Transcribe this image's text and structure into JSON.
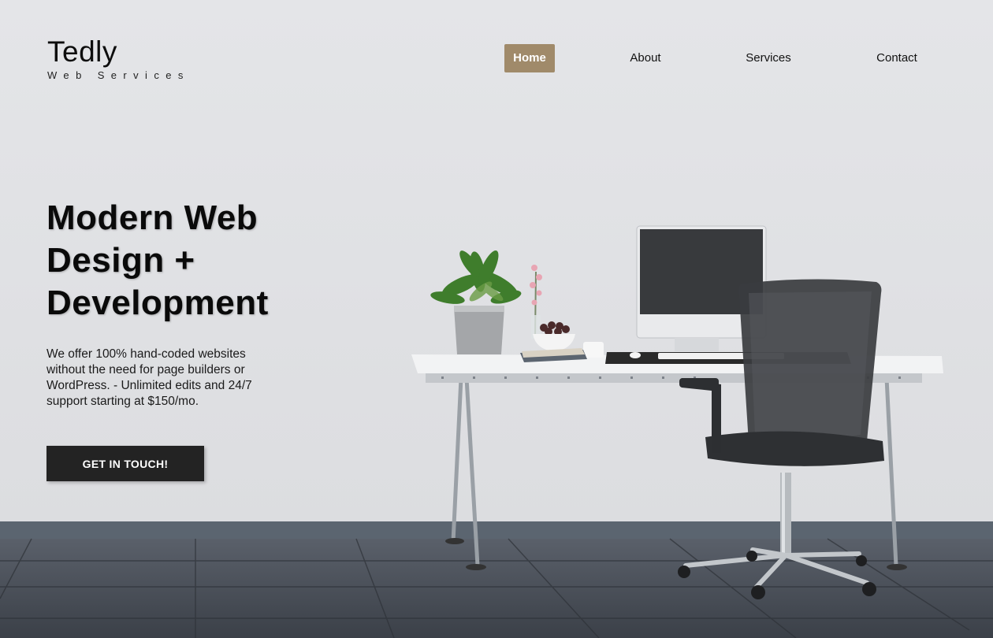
{
  "brand": {
    "name": "Tedly",
    "tagline": "Web Services"
  },
  "nav": {
    "items": [
      {
        "label": "Home",
        "active": true
      },
      {
        "label": "About",
        "active": false
      },
      {
        "label": "Services",
        "active": false
      },
      {
        "label": "Contact",
        "active": false
      }
    ]
  },
  "hero": {
    "title": "Modern Web Design + Development",
    "description": "We offer 100% hand-coded websites without the need for page builders or WordPress. - Unlimited edits and 24/7 support starting at $150/mo.",
    "cta_label": "GET IN TOUCH!"
  },
  "colors": {
    "accent": "#a08a6a",
    "cta_bg": "#232323",
    "wall": "#e1e2e5",
    "floor": "#4a4f58"
  }
}
